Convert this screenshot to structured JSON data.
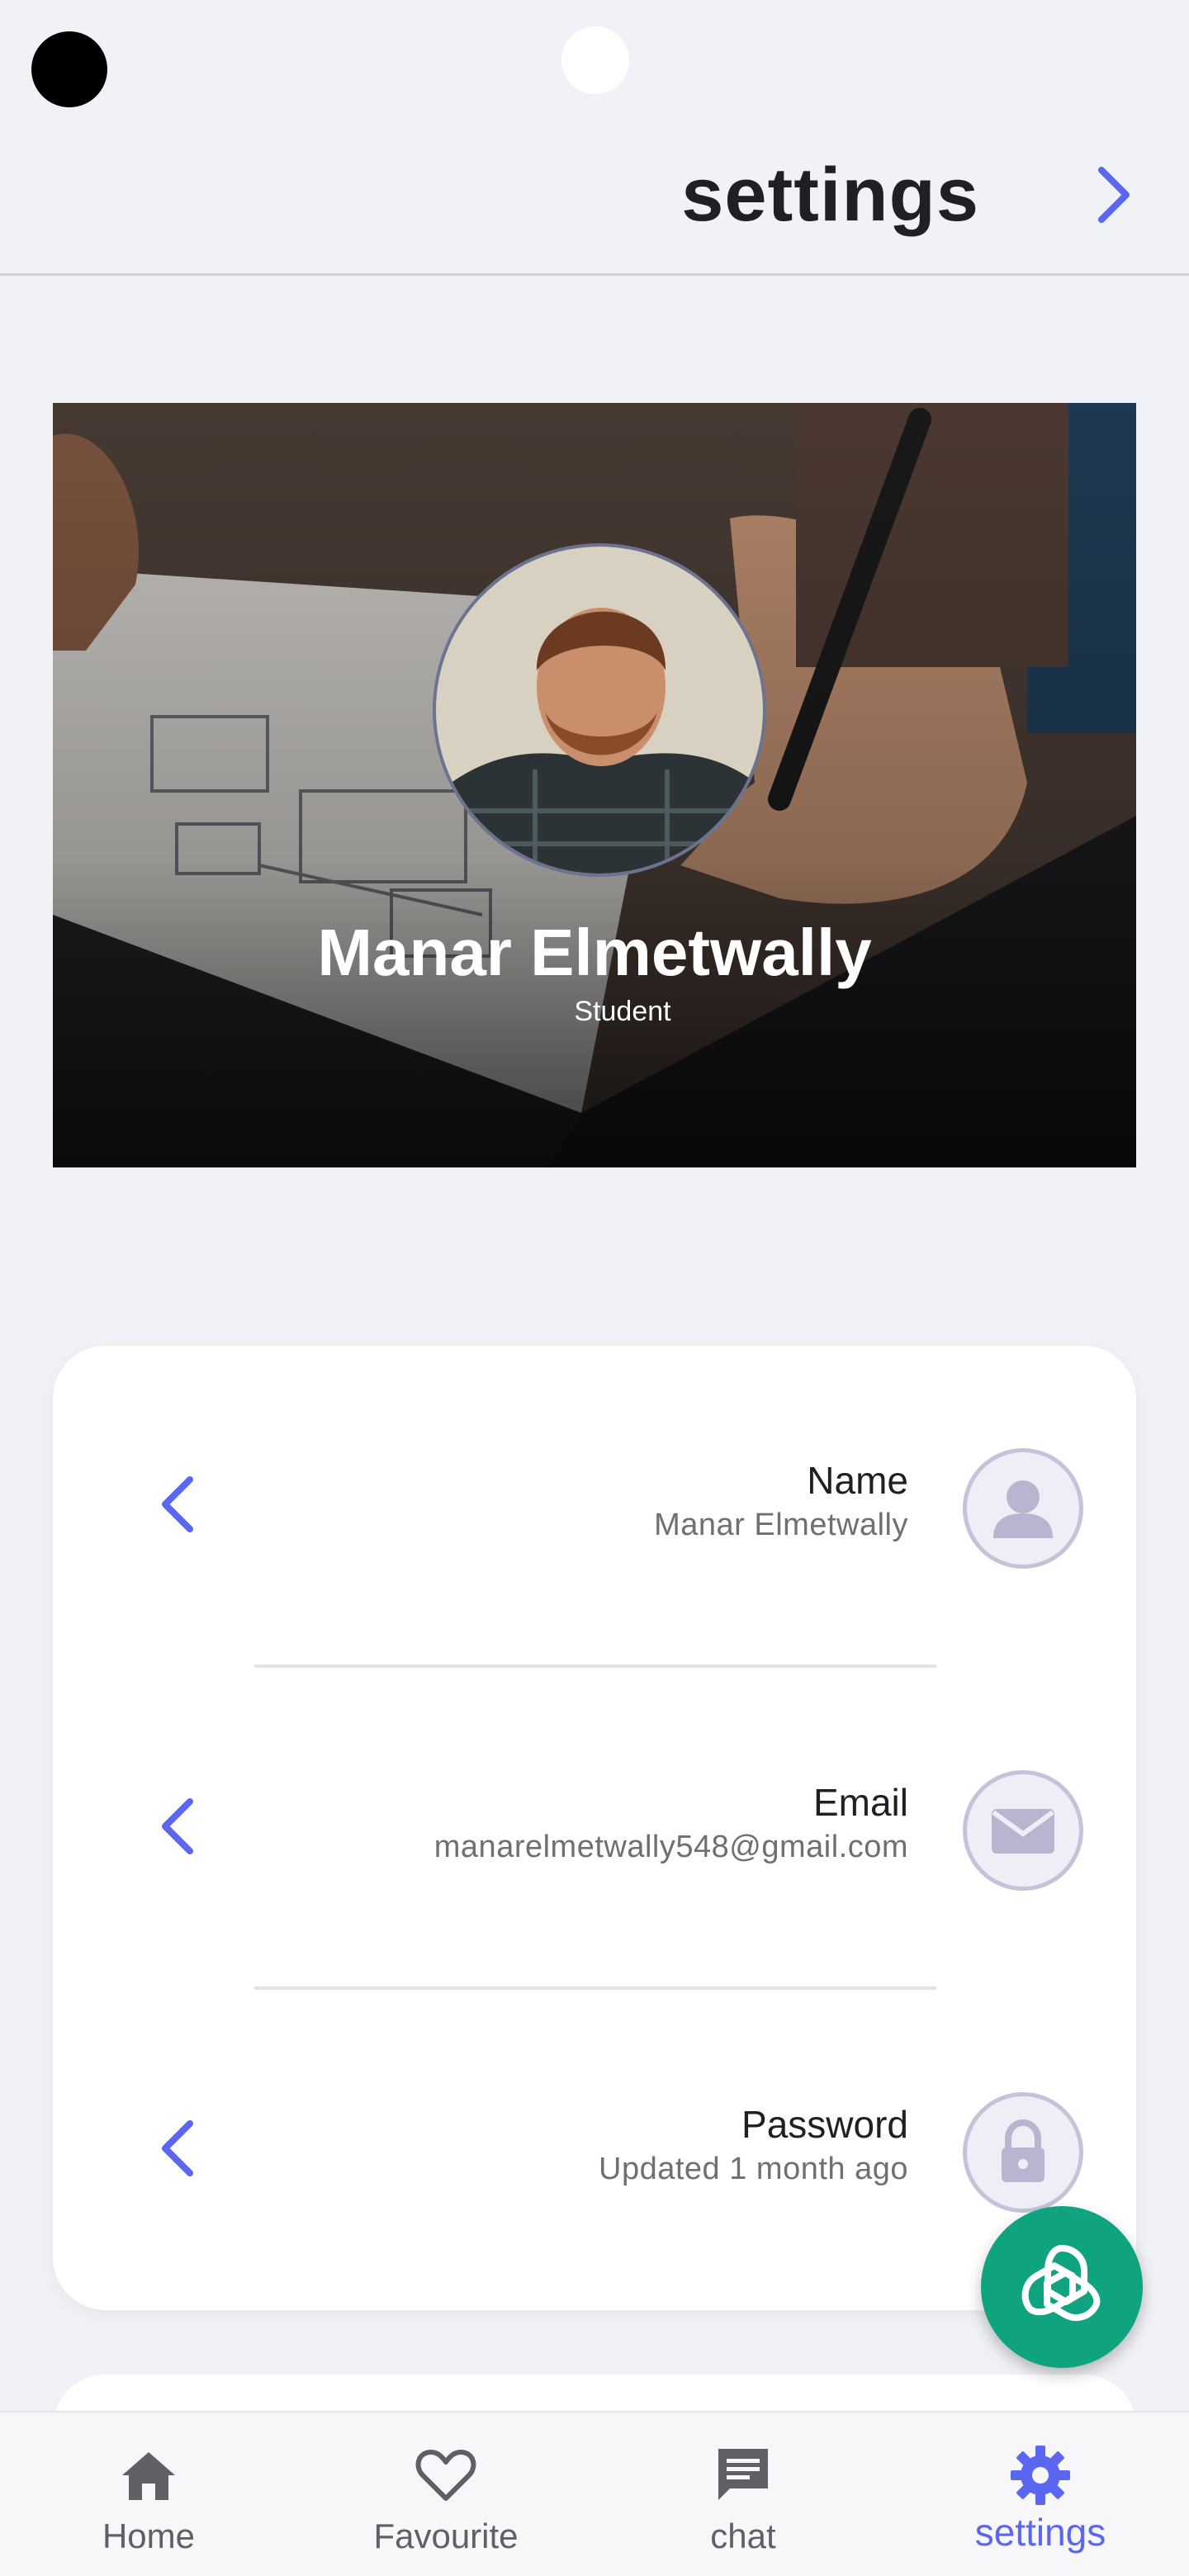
{
  "header": {
    "title": "settings",
    "forward_icon": "chevron-right-icon"
  },
  "profile": {
    "name": "Manar Elmetwally",
    "role": "Student"
  },
  "account_settings": [
    {
      "label": "Name",
      "value": "Manar Elmetwally",
      "icon": "person-icon"
    },
    {
      "label": "Email",
      "value": "manarelmetwally548@gmail.com",
      "icon": "mail-icon"
    },
    {
      "label": "Password",
      "value": "Updated 1 month ago",
      "icon": "lock-icon"
    }
  ],
  "bottom_nav": [
    {
      "label": "Home",
      "icon": "home-icon",
      "active": false
    },
    {
      "label": "Favourite",
      "icon": "heart-icon",
      "active": false
    },
    {
      "label": "chat",
      "icon": "chat-icon",
      "active": false
    },
    {
      "label": "settings",
      "icon": "gear-icon",
      "active": true
    }
  ],
  "colors": {
    "accent": "#5b67f0",
    "background": "#f1f2f7",
    "fab": "#10a37f",
    "icon_ring": "#c3c3da"
  }
}
